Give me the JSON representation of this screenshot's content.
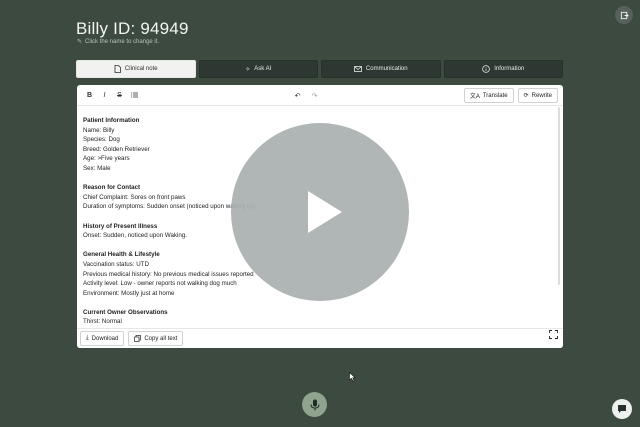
{
  "header": {
    "title": "Billy ID: 94949",
    "subtitle": "Click the name to change it."
  },
  "tabs": [
    {
      "label": "Clinical note",
      "icon": "document-icon",
      "active": true
    },
    {
      "label": "Ask AI",
      "icon": "sparkle-icon",
      "active": false
    },
    {
      "label": "Communication",
      "icon": "mail-icon",
      "active": false
    },
    {
      "label": "Information",
      "icon": "info-icon",
      "active": false
    }
  ],
  "toolbar": {
    "bold": "B",
    "italic": "I",
    "strike": "S",
    "translate_label": "Translate",
    "rewrite_label": "Rewrite"
  },
  "note": {
    "patient_heading": "Patient Information",
    "name": "Name: Billy",
    "species": "Species: Dog",
    "breed": "Breed: Golden Retriever",
    "age": "Age: >Five years",
    "sex": "Sex: Male",
    "reason_heading": "Reason for Contact",
    "complaint": "Chief Complaint: Sores on front paws",
    "duration": "Duration of symptoms: Sudden onset (noticed upon waking up)",
    "history_heading": "History of Present Illness",
    "onset": "Onset: Sudden, noticed upon Waking.",
    "general_heading": "General Health & Lifestyle",
    "vaccination": "Vaccination status: UTD",
    "previous": "Previous medical history: No previous medical issues reported",
    "activity": "Activity level: Low - owner reports not walking dog much",
    "environment": "Environment: Mostly just at home",
    "observations_heading": "Current Owner Observations",
    "thirst": "Thirst: Normal"
  },
  "footer": {
    "download_label": "Download",
    "copy_label": "Copy all text"
  },
  "colors": {
    "background": "#3c4a3f",
    "tab_dark": "#2e3832",
    "mic_accent": "#8fa38e"
  }
}
